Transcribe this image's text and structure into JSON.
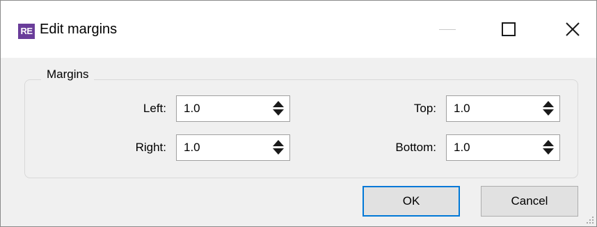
{
  "window": {
    "title": "Edit margins",
    "app_icon_text": "RE",
    "app_icon_color": "#6a3d9a"
  },
  "margins": {
    "group_title": "Margins",
    "left": {
      "label": "Left:",
      "value": "1.0"
    },
    "right": {
      "label": "Right:",
      "value": "1.0"
    },
    "top": {
      "label": "Top:",
      "value": "1.0"
    },
    "bottom": {
      "label": "Bottom:",
      "value": "1.0"
    }
  },
  "buttons": {
    "ok": "OK",
    "cancel": "Cancel"
  },
  "colors": {
    "focus_border": "#0078d7",
    "dialog_bg": "#f0f0f0"
  }
}
